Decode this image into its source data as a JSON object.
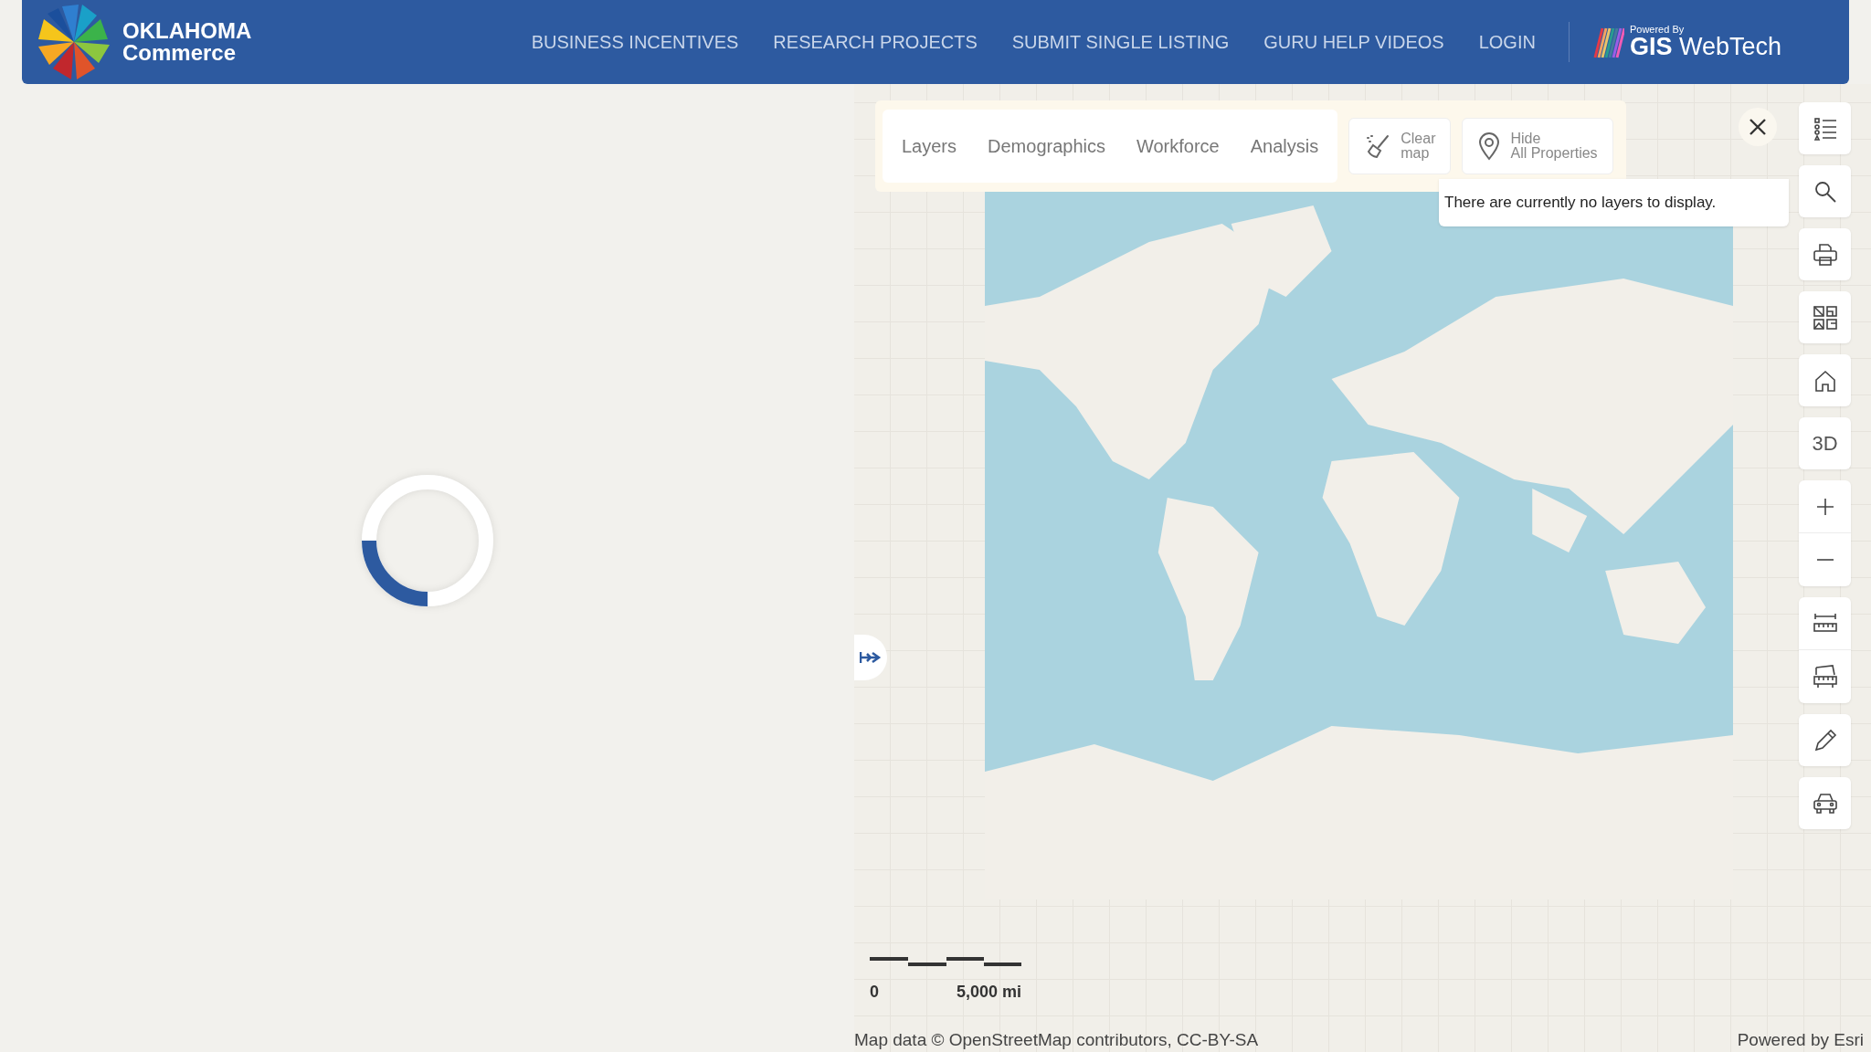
{
  "header": {
    "logo_top": "OKLAHOMA",
    "logo_bottom": "Commerce",
    "nav": [
      {
        "label": "BUSINESS INCENTIVES"
      },
      {
        "label": "RESEARCH PROJECTS"
      },
      {
        "label": "SUBMIT SINGLE LISTING"
      },
      {
        "label": "GURU HELP VIDEOS"
      },
      {
        "label": "LOGIN"
      }
    ],
    "powered_by": "Powered By",
    "brand_bold": "GIS",
    "brand_light": "WebTech"
  },
  "map_toolbar": {
    "tabs": [
      {
        "label": "Layers"
      },
      {
        "label": "Demographics"
      },
      {
        "label": "Workforce"
      },
      {
        "label": "Analysis"
      }
    ],
    "buttons": [
      {
        "kind": "clear",
        "lines": [
          "Clear",
          "map"
        ]
      },
      {
        "kind": "hide",
        "lines": [
          "Hide",
          "All Properties"
        ]
      }
    ]
  },
  "layers_popup": {
    "message": "There are currently no layers to display."
  },
  "map_tools": {
    "three_d": "3D"
  },
  "scale_bar": {
    "start": "0",
    "end": "5,000 mi"
  },
  "attribution": {
    "left": "Map data © OpenStreetMap contributors, CC-BY-SA",
    "right": "Powered by Esri"
  }
}
